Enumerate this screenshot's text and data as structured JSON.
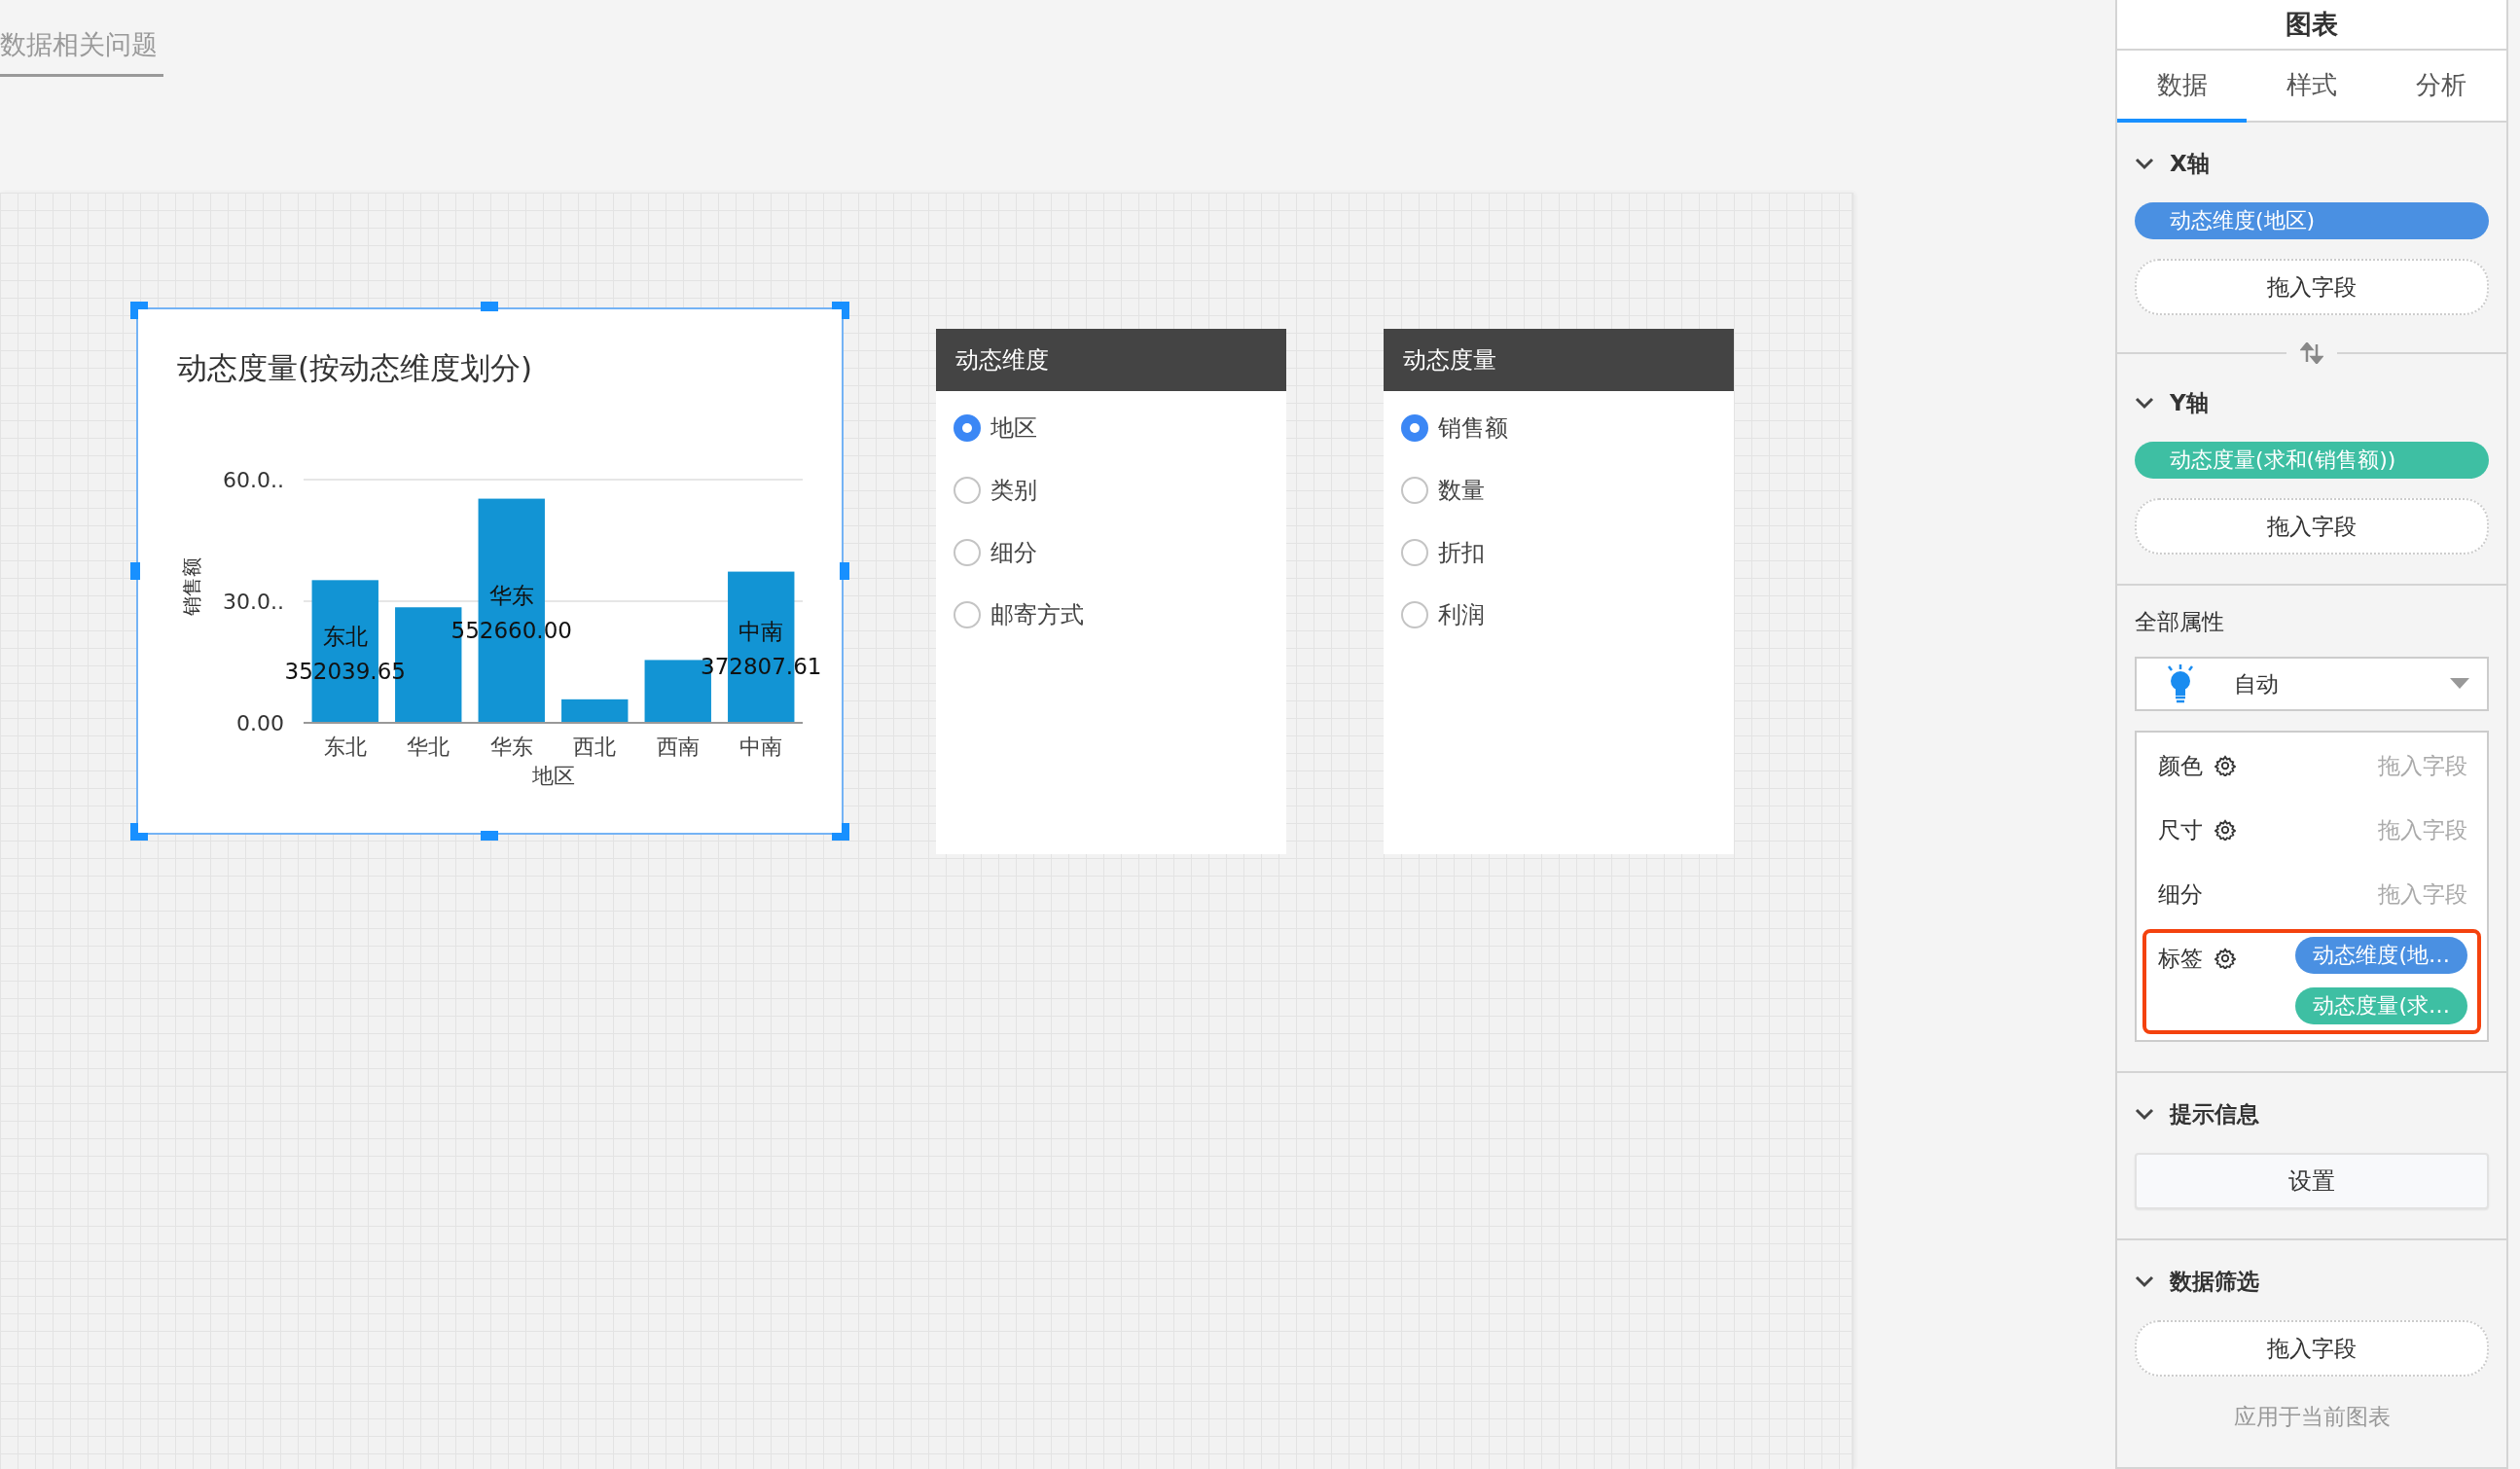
{
  "top_bar": {
    "title": "数据相关问题"
  },
  "chart_card": {
    "title": "动态度量(按动态维度划分)",
    "chart_data": {
      "type": "bar",
      "xlabel": "地区",
      "ylabel": "销售额",
      "categories": [
        "东北",
        "华北",
        "华东",
        "西北",
        "西南",
        "中南"
      ],
      "values": [
        35.2,
        28.5,
        55.3,
        5.8,
        15.5,
        37.3
      ],
      "ylim": [
        0,
        60
      ],
      "yticks": [
        {
          "value": 0,
          "label": "0.00"
        },
        {
          "value": 30,
          "label": "30.0.."
        },
        {
          "value": 60,
          "label": "60.0.."
        }
      ],
      "annotations": [
        "东北",
        "352039.65",
        "华东",
        "552660.00",
        "中南",
        "372807.61"
      ]
    }
  },
  "filters": [
    {
      "title": "动态维度",
      "options": [
        {
          "label": "地区",
          "selected": true
        },
        {
          "label": "类别",
          "selected": false
        },
        {
          "label": "细分",
          "selected": false
        },
        {
          "label": "邮寄方式",
          "selected": false
        }
      ]
    },
    {
      "title": "动态度量",
      "options": [
        {
          "label": "销售额",
          "selected": true
        },
        {
          "label": "数量",
          "selected": false
        },
        {
          "label": "折扣",
          "selected": false
        },
        {
          "label": "利润",
          "selected": false
        }
      ]
    }
  ],
  "side_panel": {
    "title": "图表",
    "tabs": [
      {
        "label": "数据",
        "selected": true
      },
      {
        "label": "样式",
        "selected": false
      },
      {
        "label": "分析",
        "selected": false
      }
    ],
    "axes": [
      {
        "label": "X轴",
        "expanded": true,
        "pill": {
          "text": "动态维度(地区)",
          "kind": "dimension"
        },
        "drop": "拖入字段"
      },
      {
        "label": "Y轴",
        "expanded": true,
        "pill": {
          "text": "动态度量(求和(销售额))",
          "kind": "measure"
        },
        "drop": "拖入字段"
      }
    ],
    "properties": {
      "label": "全部属性",
      "mode": "自动",
      "rows": [
        {
          "label": "颜色",
          "gear": true,
          "highlighted": false,
          "value": "拖入字段"
        },
        {
          "label": "尺寸",
          "gear": true,
          "highlighted": false,
          "value": "拖入字段"
        },
        {
          "label": "细分",
          "gear": false,
          "highlighted": false,
          "value": "拖入字段"
        },
        {
          "label": "标签",
          "gear": true,
          "highlighted": true,
          "pills": [
            {
              "text": "动态维度(地…",
              "kind": "dimension"
            },
            {
              "text": "动态度量(求…",
              "kind": "measure"
            }
          ]
        }
      ]
    },
    "tooltip": {
      "label": "提示信息",
      "expanded": true,
      "button": "设置"
    },
    "data_filter": {
      "label": "数据筛选",
      "expanded": true,
      "drop": "拖入字段",
      "apply": "应用于当前图表"
    }
  }
}
